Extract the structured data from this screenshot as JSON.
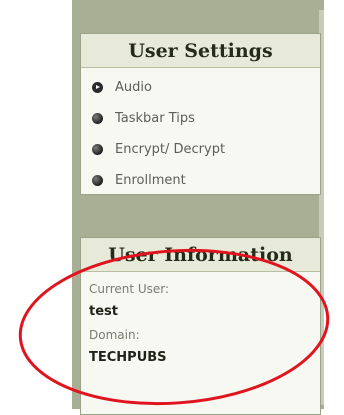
{
  "user_settings": {
    "title": "User Settings",
    "items": [
      {
        "label": "Audio",
        "icon": "play-bullet-icon"
      },
      {
        "label": "Taskbar Tips",
        "icon": "bullet-icon"
      },
      {
        "label": "Encrypt/ Decrypt",
        "icon": "bullet-icon"
      },
      {
        "label": "Enrollment",
        "icon": "bullet-icon"
      }
    ]
  },
  "user_information": {
    "title": "User Information",
    "current_user_label": "Current User:",
    "current_user_value": "test",
    "domain_label": "Domain:",
    "domain_value": "TECHPUBS"
  },
  "colors": {
    "sidebar": "#a9af95",
    "panel_bg": "#f7f8f2",
    "header_bg": "#e7ead9",
    "annotation": "#e0141e"
  }
}
